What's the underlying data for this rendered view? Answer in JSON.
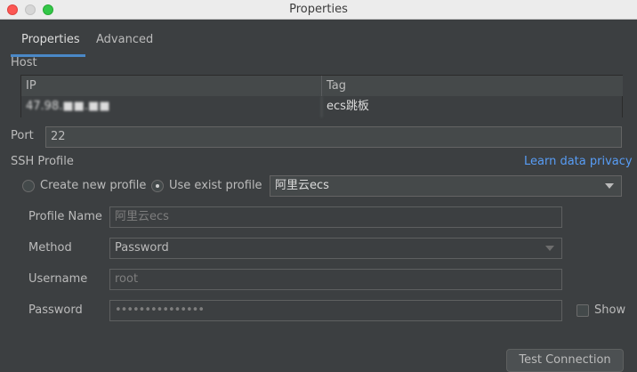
{
  "window": {
    "title": "Properties"
  },
  "tabs": [
    {
      "label": "Properties"
    },
    {
      "label": "Advanced"
    }
  ],
  "host": {
    "label": "Host",
    "columns": [
      "IP",
      "Tag"
    ],
    "rows": [
      {
        "ip": "47.98.■■.■■",
        "tag": "ecs跳板"
      }
    ]
  },
  "port": {
    "label": "Port",
    "value": "22"
  },
  "ssh": {
    "label": "SSH Profile",
    "learn_link": "Learn data privacy",
    "create_label": "Create new profile",
    "exist_label": "Use exist profile",
    "selected_profile": "阿里云ecs"
  },
  "profile": {
    "name_label": "Profile Name",
    "name_value": "阿里云ecs",
    "method_label": "Method",
    "method_value": "Password",
    "username_label": "Username",
    "username_value": "root",
    "password_label": "Password",
    "password_value": "•••••••••••••••",
    "show_label": "Show"
  },
  "buttons": {
    "test": "Test Connection"
  }
}
